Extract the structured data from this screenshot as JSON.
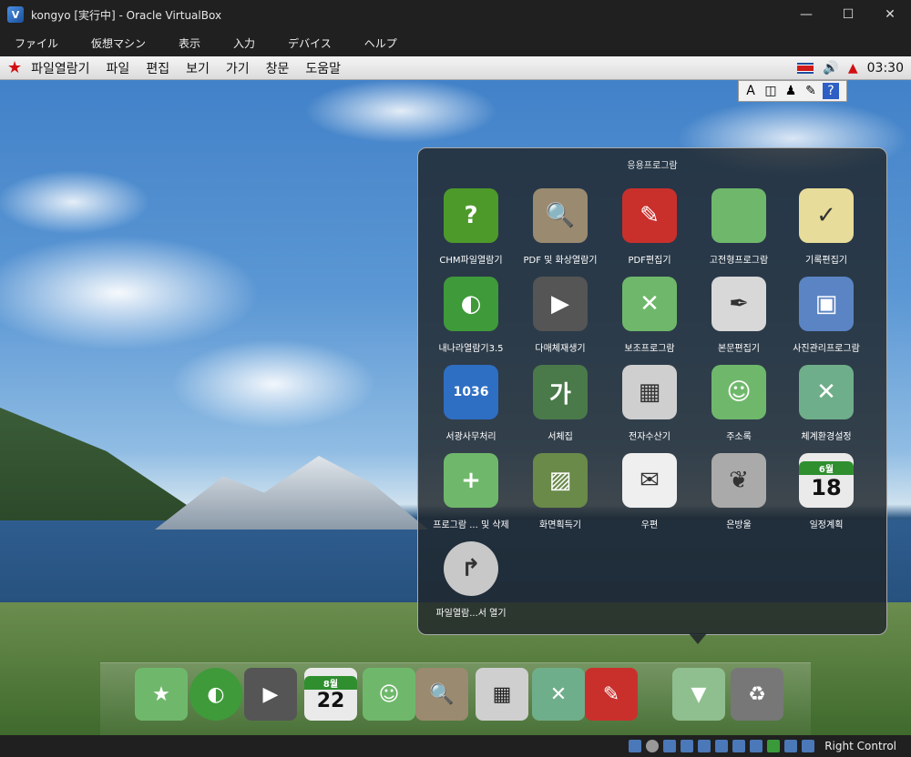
{
  "host": {
    "title": "kongyo [実行中] - Oracle VirtualBox",
    "window_controls": [
      "—",
      "☐",
      "✕"
    ],
    "menu": [
      "ファイル",
      "仮想マシン",
      "表示",
      "入力",
      "デバイス",
      "ヘルプ"
    ],
    "status_right": "Right Control"
  },
  "guest_panel": {
    "menus": [
      "파일열람기",
      "파일",
      "편집",
      "보기",
      "가기",
      "창문",
      "도움말"
    ],
    "clock": "03:30"
  },
  "ime": [
    "A",
    "◫",
    "♟",
    "✎",
    "?"
  ],
  "launcher": {
    "title": "응용프로그람",
    "apps": [
      {
        "label": "CHM파일열람기",
        "glyph": "?",
        "color": "#4d9a2a"
      },
      {
        "label": "PDF 및 화상열람기",
        "glyph": "🔍",
        "color": "#9a8a70"
      },
      {
        "label": "PDF편집기",
        "glyph": "✎",
        "color": "#c9302c"
      },
      {
        "label": "고전형프로그람",
        "glyph": "",
        "color": "#6fb86b"
      },
      {
        "label": "기록편집기",
        "glyph": "✓",
        "color": "#e8dc9a"
      },
      {
        "label": "내나라열람기3.5",
        "glyph": "◐",
        "color": "#3f9a3a"
      },
      {
        "label": "다매체재생기",
        "glyph": "▶",
        "color": "#555"
      },
      {
        "label": "보조프로그람",
        "glyph": "✕",
        "color": "#6fb86b"
      },
      {
        "label": "본문편집기",
        "glyph": "✒",
        "color": "#d8d8d8"
      },
      {
        "label": "사진관리프로그람",
        "glyph": "▣",
        "color": "#5b84c4"
      },
      {
        "label": "서광사무처리",
        "glyph": "1036",
        "color": "#2e6fc4"
      },
      {
        "label": "서체집",
        "glyph": "가",
        "color": "#4a7a4a"
      },
      {
        "label": "전자수산기",
        "glyph": "▦",
        "color": "#cfcfcf"
      },
      {
        "label": "주소록",
        "glyph": "☺",
        "color": "#6fb86b"
      },
      {
        "label": "체계환경설정",
        "glyph": "✕",
        "color": "#6fae8a"
      },
      {
        "label": "프로그람 ... 및 삭제",
        "glyph": "+",
        "color": "#6fb86b"
      },
      {
        "label": "화면획득기",
        "glyph": "▨",
        "color": "#6a8a4a"
      },
      {
        "label": "우편",
        "glyph": "✉",
        "color": "#efefef"
      },
      {
        "label": "은방울",
        "glyph": "❦",
        "color": "#aaa"
      },
      {
        "label": "일정계획",
        "glyph": "18",
        "color": "#eaeaea"
      },
      {
        "label": "파일열람...서 열기",
        "glyph": "↱",
        "color": "#c8c8c8"
      }
    ],
    "calendar_month": "6월"
  },
  "dock": {
    "items": [
      {
        "glyph": "★",
        "color": "#6fb86b"
      },
      {
        "glyph": "◐",
        "color": "#3f9a3a"
      },
      {
        "glyph": "▶",
        "color": "#555"
      },
      {
        "glyph": "22",
        "color": "#eaeaea"
      },
      {
        "glyph": "☺",
        "color": "#6fb86b"
      },
      {
        "glyph": "🔍",
        "color": "#9a8a70"
      },
      {
        "glyph": "▦",
        "color": "#cfcfcf"
      },
      {
        "glyph": "✕",
        "color": "#6fae8a"
      },
      {
        "glyph": "✎",
        "color": "#c9302c"
      },
      {
        "glyph": "▼",
        "color": "#8fbf8f"
      },
      {
        "glyph": "♻",
        "color": "#777"
      }
    ],
    "calendar_month": "8월"
  }
}
